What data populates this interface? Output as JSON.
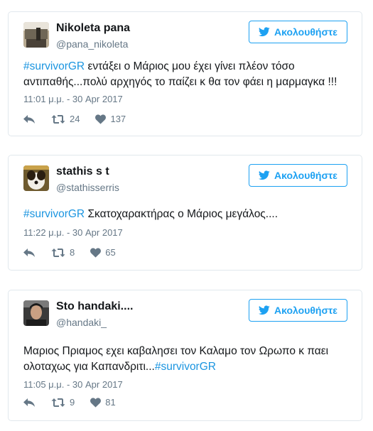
{
  "tweets": [
    {
      "name": "Nikoleta pana",
      "handle": "@pana_nikoleta",
      "follow_label": "Ακολουθήστε",
      "hashtag": "#survivorGR",
      "text_after": " εντάξει ο Μάριος μου έχει γίνει πλέον τόσο αντιπαθής...πολύ αρχηγός το παίζει κ θα τον φάει η μαρμαγκα !!!",
      "time": "11:01 μ.μ. - 30 Apr 2017",
      "retweets": "24",
      "likes": "137"
    },
    {
      "name": "stathis s t",
      "handle": "@stathisserris",
      "follow_label": "Ακολουθήστε",
      "hashtag": "#survivorGR",
      "text_after": " Σκατοχαρακτήρας ο Μάριος μεγάλος....",
      "time": "11:22 μ.μ. - 30 Apr 2017",
      "retweets": "8",
      "likes": "65"
    },
    {
      "name": "Sto handaki....",
      "handle": "@handaki_",
      "follow_label": "Ακολουθήστε",
      "text_before": "Μαριος Πριαμος εχει καβαλησει τον Καλαμο τον Ωρωπο κ παει ολοταχως για Καπανδριτι...",
      "hashtag": "#survivorGR",
      "time": "11:05 μ.μ. - 30 Apr 2017",
      "retweets": "9",
      "likes": "81"
    }
  ],
  "icons": {
    "follow": "twitter-bird-icon",
    "reply": "reply-icon",
    "retweet": "retweet-icon",
    "like": "heart-icon"
  },
  "colors": {
    "accent": "#1da1f2",
    "hashtag": "#1b95e0",
    "muted": "#657786",
    "border": "#e1e8ed"
  }
}
